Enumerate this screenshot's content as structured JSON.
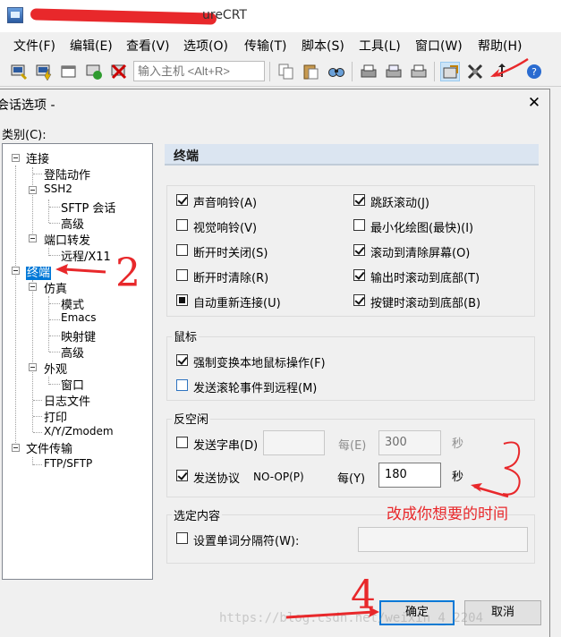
{
  "app": {
    "title_visible": "ureCRT",
    "menus": [
      "文件(F)",
      "编辑(E)",
      "查看(V)",
      "选项(O)",
      "传输(T)",
      "脚本(S)",
      "工具(L)",
      "窗口(W)",
      "帮助(H)"
    ],
    "host_input_placeholder": "输入主机 <Alt+R>"
  },
  "dialog": {
    "title": "会话选项 -",
    "close": "✕",
    "category_label": "类别(C):",
    "tree": [
      {
        "label": "连接",
        "depth": 0,
        "expanded": true
      },
      {
        "label": "登陆动作",
        "depth": 1
      },
      {
        "label": "SSH2",
        "depth": 1,
        "expanded": true
      },
      {
        "label": "SFTP 会话",
        "depth": 2
      },
      {
        "label": "高级",
        "depth": 2
      },
      {
        "label": "端口转发",
        "depth": 1,
        "expanded": true
      },
      {
        "label": "远程/X11",
        "depth": 2
      },
      {
        "label": "终端",
        "depth": 0,
        "expanded": true,
        "selected": true
      },
      {
        "label": "仿真",
        "depth": 1,
        "expanded": true
      },
      {
        "label": "模式",
        "depth": 2
      },
      {
        "label": "Emacs",
        "depth": 2
      },
      {
        "label": "映射键",
        "depth": 2
      },
      {
        "label": "高级",
        "depth": 2
      },
      {
        "label": "外观",
        "depth": 1,
        "expanded": true
      },
      {
        "label": "窗口",
        "depth": 2
      },
      {
        "label": "日志文件",
        "depth": 1
      },
      {
        "label": "打印",
        "depth": 1
      },
      {
        "label": "X/Y/Zmodem",
        "depth": 1
      },
      {
        "label": "文件传输",
        "depth": 0,
        "expanded": true
      },
      {
        "label": "FTP/SFTP",
        "depth": 1
      }
    ],
    "section_title": "终端",
    "terminal_options": [
      {
        "label": "声音响铃(A)",
        "checked": true
      },
      {
        "label": "跳跃滚动(J)",
        "checked": true
      },
      {
        "label": "视觉响铃(V)",
        "checked": false
      },
      {
        "label": "最小化绘图(最快)(I)",
        "checked": false
      },
      {
        "label": "断开时关闭(S)",
        "checked": false
      },
      {
        "label": "滚动到清除屏幕(O)",
        "checked": true
      },
      {
        "label": "断开时清除(R)",
        "checked": false
      },
      {
        "label": "输出时滚动到底部(T)",
        "checked": true
      },
      {
        "label": "自动重新连接(U)",
        "checked": "indeterminate"
      },
      {
        "label": "按键时滚动到底部(B)",
        "checked": true
      }
    ],
    "mouse": {
      "group_label": "鼠标",
      "options": [
        {
          "label": "强制变换本地鼠标操作(F)",
          "checked": true
        },
        {
          "label": "发送滚轮事件到远程(M)",
          "checked": false
        }
      ]
    },
    "anti_idle": {
      "group_label": "反空闲",
      "send_string_label": "发送字串(D)",
      "send_string_checked": false,
      "send_string_value": "",
      "every1_label": "每(E)",
      "every1_value": "300",
      "sec1_label": "秒",
      "send_protocol_label": "发送协议",
      "protocol_name": "NO-OP(P)",
      "send_protocol_checked": true,
      "every2_label": "每(Y)",
      "every2_value": "180",
      "sec2_label": "秒"
    },
    "selection": {
      "group_label": "选定内容",
      "word_delim_label": "设置单词分隔符(W):",
      "word_delim_checked": false,
      "word_delim_value": ""
    },
    "ok_label": "确定",
    "cancel_label": "取消"
  },
  "annotations": {
    "note": "改成你想要的时间",
    "num2": "2",
    "num3": "3",
    "num4": "4"
  },
  "watermark": "https://blog.csdn.net/weixin_4_2204",
  "colors": {
    "annotation": "#e8282b",
    "selection": "#0078d7",
    "header_bg": "#dbe5f1"
  }
}
